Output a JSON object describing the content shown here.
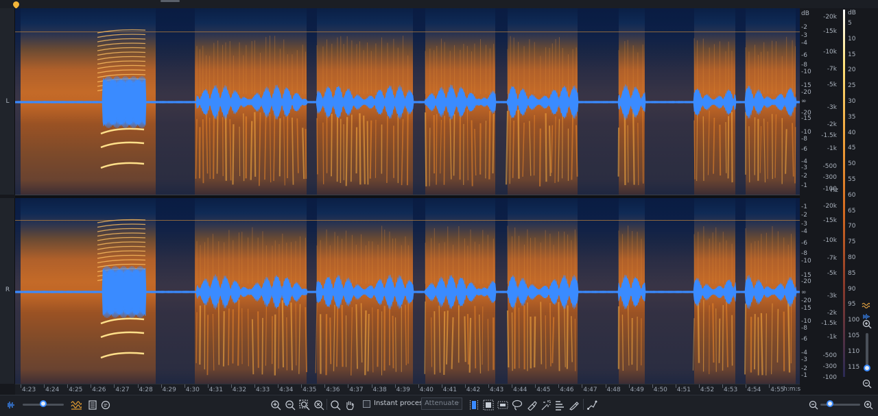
{
  "channels": {
    "left_label": "L",
    "right_label": "R"
  },
  "db_scale": {
    "unit": "dB",
    "left_channel": [
      "-2",
      "-3",
      "-4",
      "-6",
      "-8",
      "-10",
      "-15",
      "-20",
      "∞",
      "-20",
      "-15",
      "-10",
      "-8",
      "-6",
      "-4",
      "-3",
      "-2",
      "-1"
    ],
    "right_channel": [
      "-1",
      "-2",
      "-3",
      "-4",
      "-6",
      "-8",
      "-10",
      "-15",
      "-20",
      "∞",
      "-20",
      "-15",
      "-10",
      "-8",
      "-6",
      "-4",
      "-3",
      "-2",
      "-1"
    ]
  },
  "hz_scale": {
    "unit": "Hz",
    "left_channel": [
      "-20k",
      "-15k",
      "-10k",
      "-7k",
      "-5k",
      "-3k",
      "-2k",
      "-1.5k",
      "-1k",
      "-500",
      "-300",
      "-100"
    ],
    "right_channel": [
      "-20k",
      "-15k",
      "-10k",
      "-7k",
      "-5k",
      "-3k",
      "-2k",
      "-1.5k",
      "-1k",
      "-500",
      "-300",
      "-100"
    ]
  },
  "meter_scale": {
    "unit": "dB",
    "labels": [
      "5",
      "10",
      "15",
      "20",
      "25",
      "30",
      "35",
      "40",
      "45",
      "50",
      "55",
      "60",
      "65",
      "70",
      "75",
      "80",
      "85",
      "90",
      "95",
      "100",
      "105",
      "110",
      "115"
    ]
  },
  "time_ruler": {
    "labels": [
      "4:23",
      "4:24",
      "4:25",
      "4:26",
      "4:27",
      "4:28",
      "4:29",
      "4:30",
      "4:31",
      "4:32",
      "4:33",
      "4:34",
      "4:35",
      "4:36",
      "4:37",
      "4:38",
      "4:39",
      "4:40",
      "4:41",
      "4:42",
      "4:43",
      "4:44",
      "4:45",
      "4:46",
      "4:47",
      "4:48",
      "4:49",
      "4:50",
      "4:51",
      "4:52",
      "4:53",
      "4:54",
      "4:55"
    ],
    "unit_label": "h:m:s"
  },
  "toolbar": {
    "instant_process_label": "Instant process",
    "instant_process_checked": false,
    "mode_value": "Attenuate"
  },
  "colors": {
    "waveform": "#3a8bff",
    "spectrogram_hot": "#f0902a",
    "spectrogram_cold": "#0c2450",
    "accent": "#3a8bff",
    "playhead": "#f2b53a"
  }
}
